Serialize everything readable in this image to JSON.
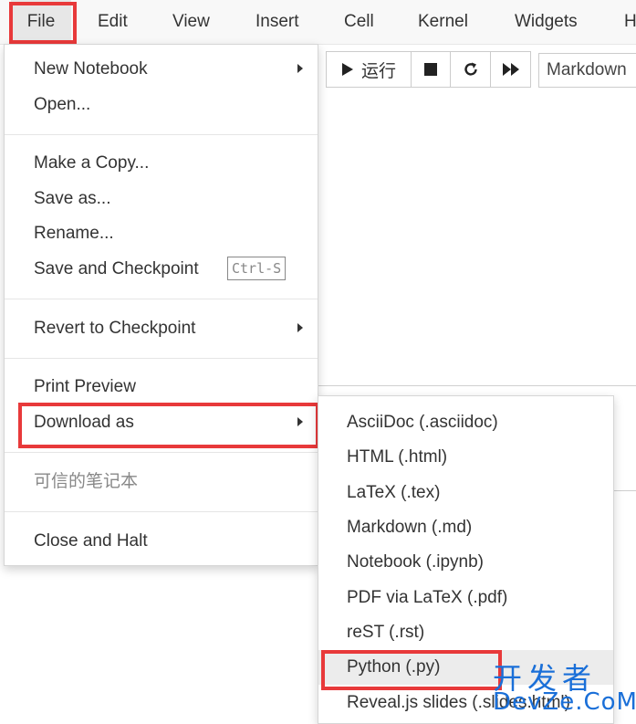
{
  "menubar": {
    "items": [
      "File",
      "Edit",
      "View",
      "Insert",
      "Cell",
      "Kernel",
      "Widgets",
      "H"
    ]
  },
  "toolbar": {
    "run_label": "运行",
    "cell_type": "Markdown"
  },
  "file_menu": {
    "new_notebook": "New Notebook",
    "open": "Open...",
    "make_copy": "Make a Copy...",
    "save_as": "Save as...",
    "rename": "Rename...",
    "save_checkpoint": "Save and Checkpoint",
    "save_shortcut": "Ctrl-S",
    "revert": "Revert to Checkpoint",
    "print_preview": "Print Preview",
    "download_as": "Download as",
    "trusted": "可信的笔记本",
    "close_halt": "Close and Halt"
  },
  "download_menu": {
    "items": [
      "AsciiDoc (.asciidoc)",
      "HTML (.html)",
      "LaTeX (.tex)",
      "Markdown (.md)",
      "Notebook (.ipynb)",
      "PDF via LaTeX (.pdf)",
      "reST (.rst)",
      "Python (.py)",
      "Reveal.js slides (.slides.html)"
    ]
  },
  "watermark": {
    "line1": "开发者",
    "line2": "DevZe.CoM"
  },
  "colors": {
    "highlight_red": "#e8393a",
    "watermark_blue": "#1a6fd8"
  }
}
